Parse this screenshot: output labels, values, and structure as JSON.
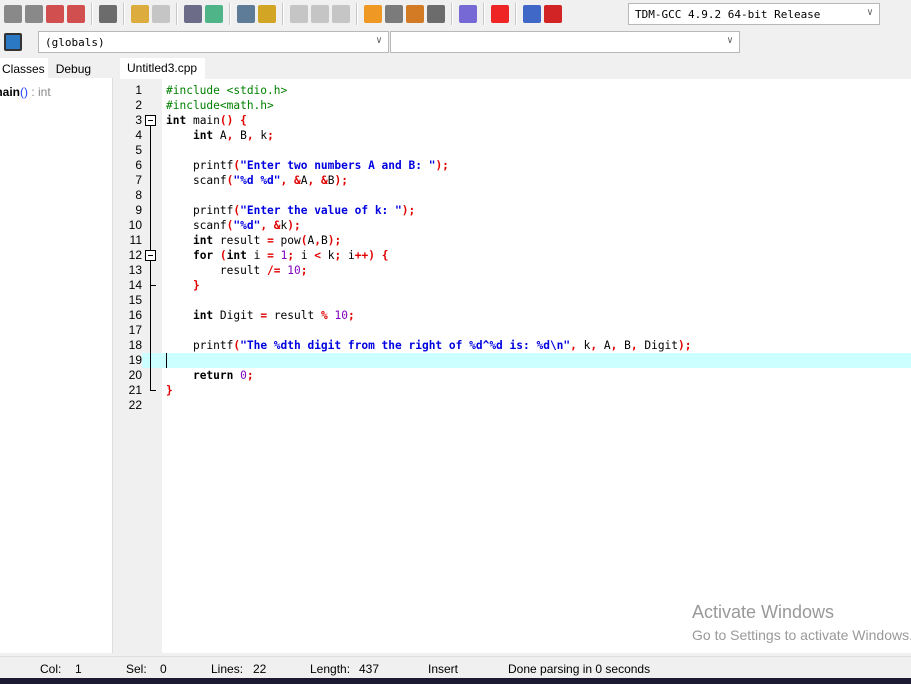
{
  "toolbar": {
    "compiler": "TDM-GCC 4.9.2 64-bit Release",
    "icons": [
      "save-icon",
      "save-all-icon",
      "close-icon",
      "close-all-icon",
      "print-icon",
      "undo-icon",
      "redo-icon",
      "find-icon",
      "replace-icon",
      "goto-line-icon",
      "goto-icon",
      "indent-icon",
      "unindent-icon",
      "toggle-comment-icon",
      "new-project-icon",
      "project-options-icon",
      "new-class-icon",
      "layout-icon",
      "check-syntax-icon",
      "stop-icon",
      "chart-icon",
      "profile-icon"
    ]
  },
  "scope": {
    "globals": "(globals)",
    "member": ""
  },
  "left_panel": {
    "tabs": [
      "Classes",
      "Debug"
    ],
    "items": [
      {
        "name": "main",
        "sig": "()",
        "type": " : int"
      }
    ]
  },
  "editor": {
    "tab": "Untitled3.cpp",
    "current_line": 19,
    "lines": [
      [
        [
          "pp",
          "#include <stdio.h>"
        ]
      ],
      [
        [
          "pp",
          "#include<math.h>"
        ]
      ],
      [
        [
          "kw",
          "int"
        ],
        [
          "id",
          " main"
        ],
        [
          "sym",
          "() {"
        ]
      ],
      [
        [
          "id",
          "    "
        ],
        [
          "kw",
          "int"
        ],
        [
          "id",
          " A"
        ],
        [
          "sym",
          ","
        ],
        [
          "id",
          " B"
        ],
        [
          "sym",
          ","
        ],
        [
          "id",
          " k"
        ],
        [
          "sym",
          ";"
        ]
      ],
      [],
      [
        [
          "id",
          "    printf"
        ],
        [
          "sym",
          "("
        ],
        [
          "str",
          "\"Enter two numbers A and B: \""
        ],
        [
          "sym",
          ");"
        ]
      ],
      [
        [
          "id",
          "    scanf"
        ],
        [
          "sym",
          "("
        ],
        [
          "str",
          "\"%d %d\""
        ],
        [
          "sym",
          ", &"
        ],
        [
          "id",
          "A"
        ],
        [
          "sym",
          ", &"
        ],
        [
          "id",
          "B"
        ],
        [
          "sym",
          ");"
        ]
      ],
      [],
      [
        [
          "id",
          "    printf"
        ],
        [
          "sym",
          "("
        ],
        [
          "str",
          "\"Enter the value of k: \""
        ],
        [
          "sym",
          ");"
        ]
      ],
      [
        [
          "id",
          "    scanf"
        ],
        [
          "sym",
          "("
        ],
        [
          "str",
          "\"%d\""
        ],
        [
          "sym",
          ", &"
        ],
        [
          "id",
          "k"
        ],
        [
          "sym",
          ");"
        ]
      ],
      [
        [
          "id",
          "    "
        ],
        [
          "kw",
          "int"
        ],
        [
          "id",
          " result "
        ],
        [
          "sym",
          "="
        ],
        [
          "id",
          " pow"
        ],
        [
          "sym",
          "("
        ],
        [
          "id",
          "A"
        ],
        [
          "sym",
          ","
        ],
        [
          "id",
          "B"
        ],
        [
          "sym",
          ");"
        ]
      ],
      [
        [
          "id",
          "    "
        ],
        [
          "kw",
          "for"
        ],
        [
          "sym",
          " ("
        ],
        [
          "kw",
          "int"
        ],
        [
          "id",
          " i "
        ],
        [
          "sym",
          "="
        ],
        [
          "num",
          " 1"
        ],
        [
          "sym",
          ";"
        ],
        [
          "id",
          " i "
        ],
        [
          "sym",
          "<"
        ],
        [
          "id",
          " k"
        ],
        [
          "sym",
          ";"
        ],
        [
          "id",
          " i"
        ],
        [
          "sym",
          "++) {"
        ]
      ],
      [
        [
          "id",
          "        result "
        ],
        [
          "sym",
          "/="
        ],
        [
          "num",
          " 10"
        ],
        [
          "sym",
          ";"
        ]
      ],
      [
        [
          "sym",
          "    }"
        ]
      ],
      [],
      [
        [
          "id",
          "    "
        ],
        [
          "kw",
          "int"
        ],
        [
          "id",
          " Digit "
        ],
        [
          "sym",
          "="
        ],
        [
          "id",
          " result "
        ],
        [
          "sym",
          "%"
        ],
        [
          "num",
          " 10"
        ],
        [
          "sym",
          ";"
        ]
      ],
      [],
      [
        [
          "id",
          "    printf"
        ],
        [
          "sym",
          "("
        ],
        [
          "str",
          "\"The %dth digit from the right of %d^%d is: %d\\n\""
        ],
        [
          "sym",
          ","
        ],
        [
          "id",
          " k"
        ],
        [
          "sym",
          ","
        ],
        [
          "id",
          " A"
        ],
        [
          "sym",
          ","
        ],
        [
          "id",
          " B"
        ],
        [
          "sym",
          ","
        ],
        [
          "id",
          " Digit"
        ],
        [
          "sym",
          ");"
        ]
      ],
      [],
      [
        [
          "id",
          "    "
        ],
        [
          "kw",
          "return"
        ],
        [
          "num",
          " 0"
        ],
        [
          "sym",
          ";"
        ]
      ],
      [
        [
          "sym",
          "}"
        ]
      ],
      []
    ]
  },
  "status": {
    "col_label": "Col:",
    "col": "1",
    "sel_label": "Sel:",
    "sel": "0",
    "lines_label": "Lines:",
    "lines": "22",
    "length_label": "Length:",
    "length": "437",
    "mode": "Insert",
    "message": "Done parsing in 0 seconds"
  },
  "watermark": {
    "title": "Activate Windows",
    "subtitle": "Go to Settings to activate Windows."
  }
}
